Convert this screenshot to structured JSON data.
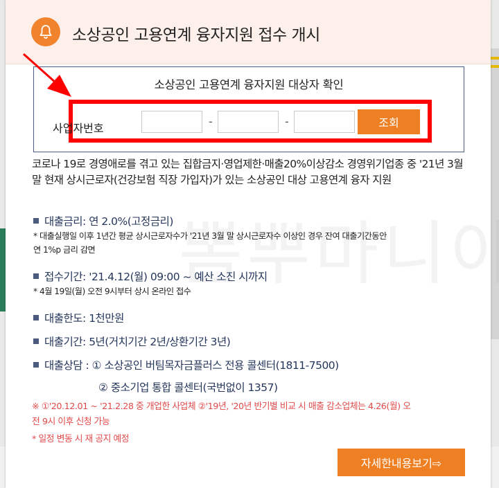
{
  "modal": {
    "title": "소상공인 고용연계 융자지원 접수 개시"
  },
  "check": {
    "title": "소상공인 고용연계 융자지원 대상자 확인",
    "label": "사업자번호",
    "input1_value": "",
    "input2_value": "",
    "input3_value": "",
    "separator": "-",
    "button_label": "조회"
  },
  "intro": "코로나 19로 경영애로를 겪고 있는 집합금지·영업제한·매출20%이상감소 경영위기업종 중 '21년 3월말 현재 상시근로자(건강보험 직장 가입자)가 있는 소상공인 대상 고용연계 융자 지원",
  "items": {
    "rate": "대출금리: 연 2.0%(고정금리)",
    "rate_note_1": "* 대출실행일 이후 1년간 평균 상시근로자수가 '21년 3월 말 상시근로자수 이상인 경우 잔여 대출기간동안",
    "rate_note_2": "연 1%p 금리 감면",
    "period": "접수기간: '21.4.12(월) 09:00 ~ 예산 소진 시까지",
    "period_note": "* 4월 19일(월) 오전 9시부터 상시 온라인 접수",
    "limit": "대출한도: 1천만원",
    "term": "대출기간: 5년(거치기간 2년/상환기간 3년)",
    "consult_1": "대출상담 : ① 소상공인 버팀목자금플러스 전용 콜센터(1811-7500)",
    "consult_2": "② 중소기업 통합 콜센터(국번없이 1357)"
  },
  "notes": {
    "red_1": "※ ①'20.12.01 ~ '21.2.28 중 개업한 사업체 ②'19년, '20년 반기별 비교 시 매출 감소업체는 4.26(월) 오",
    "red_2": "전 9시 이후 신청 가능",
    "red_3": "* 일정 변동 시 재 공지 예정"
  },
  "detail_button": "자세한내용보기⇨",
  "watermark": "뽐뿌마니아",
  "colors": {
    "accent": "#ee7f22",
    "highlight": "#ff0000",
    "navy_text": "#25365c",
    "red_text": "#e04a4a",
    "header_bg": "#fdf0ea"
  },
  "icons": {
    "header": "bell-icon",
    "annotation": "red-arrow-icon"
  }
}
